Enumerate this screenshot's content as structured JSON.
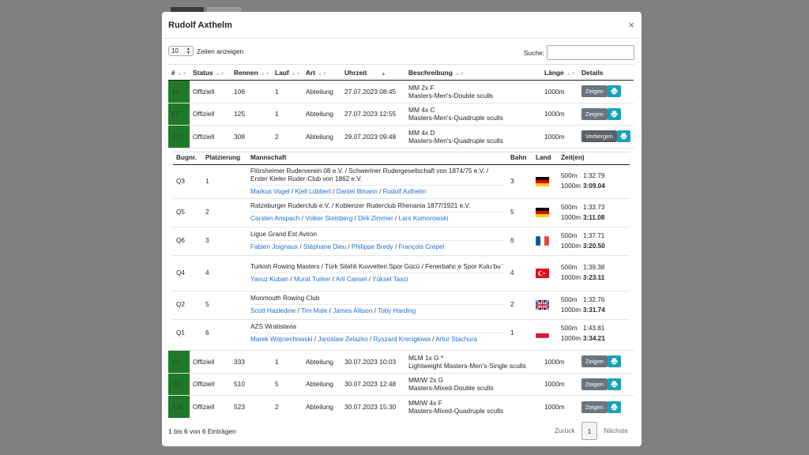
{
  "modal": {
    "title": "Rudolf Axthelm",
    "close": "×"
  },
  "length": {
    "value": "10",
    "label": "Zeilen anzeigen"
  },
  "search": {
    "label": "Suche:",
    "value": ""
  },
  "columns": [
    "#",
    "Status",
    "Rennen",
    "Lauf",
    "Art",
    "Uhrzeit",
    "Beschreibung",
    "Länge",
    "Details"
  ],
  "rows_top": [
    {
      "num": "16",
      "status": "Offiziell",
      "rennen": "106",
      "lauf": "1",
      "art": "Abteilung",
      "uhrzeit": "27.07.2023 08:45",
      "desc1": "MM 2x F",
      "desc2": "Masters-Men's-Double sculls",
      "laenge": "1000m",
      "btn": "Zeigen"
    },
    {
      "num": "87",
      "status": "Offiziell",
      "rennen": "125",
      "lauf": "1",
      "art": "Abteilung",
      "uhrzeit": "27.07.2023 12:55",
      "desc1": "MM 4x C",
      "desc2": "Masters-Men's-Quadruple sculls",
      "laenge": "1000m",
      "btn": "Zeigen"
    },
    {
      "num": "377",
      "status": "Offiziell",
      "rennen": "308",
      "lauf": "2",
      "art": "Abteilung",
      "uhrzeit": "29.07.2023 09:48",
      "desc1": "MM 4x D",
      "desc2": "Masters-Men's-Quadruple sculls",
      "laenge": "1000m",
      "btn": "Verbergen"
    }
  ],
  "detail": {
    "columns": [
      "Bugnr.",
      "Platzierung",
      "Mannschaft",
      "Bahn",
      "Land",
      "Zeit(en)"
    ],
    "rows": [
      {
        "bug": "Q3",
        "platz": "1",
        "team": "Flörsheimer Ruderverein 08 e.V. / Schweriner Rudergesellschaft von 1874/75 e.V. / Erster Kieler Ruder-Club von 1862 e.V.",
        "rowers": [
          "Markus Vogel",
          "Kjell Lübbert",
          "Daniel Illmann",
          "Rudolf Axthelm"
        ],
        "bahn": "3",
        "flag": "de",
        "d1": "500m",
        "t1": "1:32.79",
        "d2": "1000m",
        "t2": "3:09.04"
      },
      {
        "bug": "Q5",
        "platz": "2",
        "team": "Ratzeburger Ruderclub e.V. / Koblenzer Ruderclub Rhenania 1877/1921 e.V.",
        "rowers": [
          "Carsten Anspach",
          "Volker Steinberg",
          "Dirk Zimmer",
          "Lars Komorowski"
        ],
        "bahn": "5",
        "flag": "de",
        "d1": "500m",
        "t1": "1:33.73",
        "d2": "1000m",
        "t2": "3:11.08"
      },
      {
        "bug": "Q6",
        "platz": "3",
        "team": "Ligue Grand Est Aviron",
        "rowers": [
          "Fabien Joignaux",
          "Stéphane Dieu",
          "Philippe Bredy",
          "François Crepel"
        ],
        "bahn": "6",
        "flag": "fr",
        "d1": "500m",
        "t1": "1:37.71",
        "d2": "1000m",
        "t2": "3:20.50"
      },
      {
        "bug": "Q4",
        "platz": "4",
        "team": "Turkish Rowing Masters / Türk Silahli Kuvvetleri Spor Gücü / Fenerbahc ̧e Spor Kulu ̈bu ̈",
        "rowers": [
          "Yavuz Kuban",
          "Murat Turker",
          "Aril Cansel",
          "Yüksel Tasci"
        ],
        "bahn": "4",
        "flag": "tr",
        "d1": "500m",
        "t1": "1:39.38",
        "d2": "1000m",
        "t2": "3:23.11"
      },
      {
        "bug": "Q2",
        "platz": "5",
        "team": "Monmouth Rowing Club",
        "rowers": [
          "Scott Hazledine",
          "Tim Male",
          "James Allison",
          "Toby Harding"
        ],
        "bahn": "2",
        "flag": "gb",
        "d1": "500m",
        "t1": "1:32.76",
        "d2": "1000m",
        "t2": "3:31.74"
      },
      {
        "bug": "Q1",
        "platz": "6",
        "team": "AZS Wratislavia",
        "rowers": [
          "Marek Wojciechowski",
          "Jaroslaw Zelazko",
          "Ryszard Krecigłowa",
          "Artur Stachura"
        ],
        "bahn": "1",
        "flag": "pl",
        "d1": "500m",
        "t1": "1:43.81",
        "d2": "1000m",
        "t2": "3:34.21"
      }
    ]
  },
  "rows_bottom": [
    {
      "num": "721",
      "status": "Offiziell",
      "rennen": "333",
      "lauf": "1",
      "art": "Abteilung",
      "uhrzeit": "30.07.2023 10:03",
      "desc1": "MLM 1x G *",
      "desc2": "Lightweight Masters-Men's-Single sculls",
      "laenge": "1000m",
      "btn": "Zeigen"
    },
    {
      "num": "767",
      "status": "Offiziell",
      "rennen": "510",
      "lauf": "5",
      "art": "Abteilung",
      "uhrzeit": "30.07.2023 12:48",
      "desc1": "MM/W 2x G",
      "desc2": "Masters-Mixed-Double sculls",
      "laenge": "1000m",
      "btn": "Zeigen"
    },
    {
      "num": "806",
      "status": "Offiziell",
      "rennen": "523",
      "lauf": "2",
      "art": "Abteilung",
      "uhrzeit": "30.07.2023 15:30",
      "desc1": "MM/W 4x F",
      "desc2": "Masters-Mixed-Quadruple sculls",
      "laenge": "1000m",
      "btn": "Zeigen"
    }
  ],
  "footer": {
    "info": "1 bis 6 von 6 Einträgen",
    "prev": "Zurück",
    "page": "1",
    "next": "Nächste"
  },
  "colors": {
    "num_bg": "#1f7a28",
    "btn_gray": "#6c757d",
    "btn_print": "#17a2b8",
    "link": "#1a6fd8"
  },
  "icons": {
    "print": "print-icon",
    "close": "close-icon",
    "sort": "sort-icon"
  }
}
